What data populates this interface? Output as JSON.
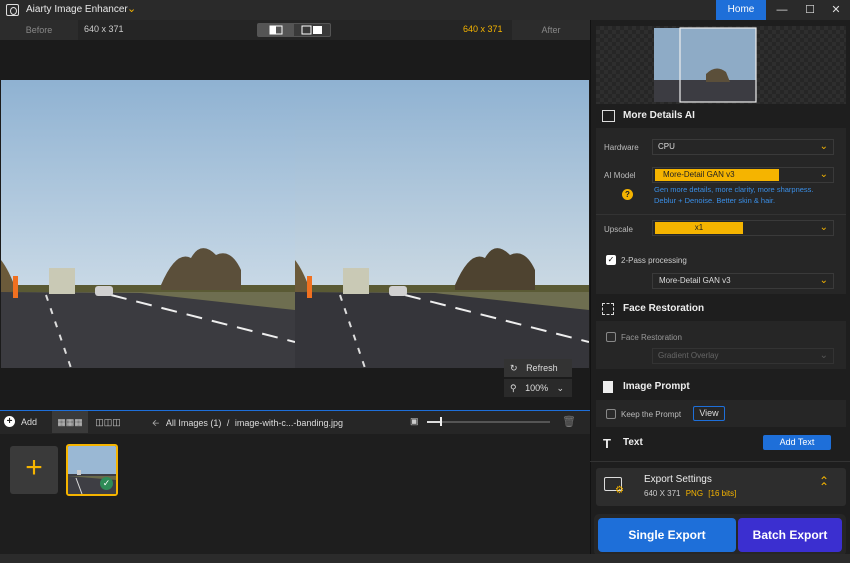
{
  "app": {
    "title": "Aiarty Image Enhancer",
    "home_label": "Home"
  },
  "view": {
    "before_label": "Before",
    "after_label": "After",
    "left_dims": "640 x 371",
    "right_dims": "640 x 371"
  },
  "canvas_tools": {
    "refresh_label": "Refresh",
    "zoom_value": "100%"
  },
  "bottom": {
    "add_label": "Add",
    "all_images_label": "All Images (1)",
    "separator": "/",
    "file_name": "image-with-c...-banding.jpg"
  },
  "right_panel": {
    "more_details": {
      "title": "More Details AI",
      "hardware_label": "Hardware",
      "hardware_value": "CPU",
      "ai_model_label": "AI Model",
      "ai_model_value": "More-Detail GAN  v3",
      "ai_model_desc_1": "Gen more details, more clarity, more sharpness.",
      "ai_model_desc_2": "Deblur + Denoise. Better skin & hair.",
      "upscale_label": "Upscale",
      "upscale_value": "x1",
      "two_pass_label": "2-Pass processing",
      "two_pass_model": "More-Detail GAN  v3"
    },
    "face_restoration": {
      "title": "Face Restoration",
      "checkbox_label": "Face Restoration",
      "mode_value": "Gradient Overlay"
    },
    "image_prompt": {
      "title": "Image Prompt",
      "keep_label": "Keep the Prompt",
      "view_label": "View"
    },
    "text": {
      "title": "Text",
      "add_text_label": "Add Text"
    },
    "export": {
      "title": "Export Settings",
      "dims": "640 X 371",
      "format": "PNG",
      "bits": "[16 bits]",
      "single_label": "Single Export",
      "batch_label": "Batch Export"
    }
  },
  "colors": {
    "accent_yellow": "#f5b400",
    "accent_blue": "#1e6fd9",
    "batch_purple": "#3b2fd0"
  }
}
